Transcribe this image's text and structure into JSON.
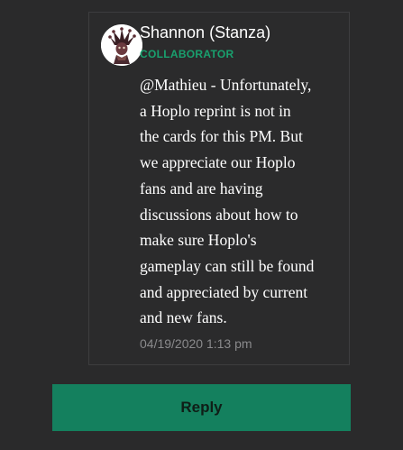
{
  "comment": {
    "author": "Shannon (Stanza)",
    "role": "COLLABORATOR",
    "body_lines": [
      "@Mathieu - Unfortunately,",
      "a Hoplo reprint is not in",
      "the cards for this PM. But",
      "we appreciate our Hoplo",
      "fans and are having",
      "discussions about how to",
      "make sure Hoplo's",
      "gameplay can still be found",
      "and appreciated by current",
      "and new fans."
    ],
    "timestamp": "04/19/2020 1:13 pm",
    "avatar_icon": "jester-character-avatar"
  },
  "actions": {
    "reply_label": "Reply"
  },
  "colors": {
    "background": "#2a2a2b",
    "accent_green": "#14805e",
    "role_green": "#19a06e",
    "timestamp_gray": "#8a8a8c"
  }
}
